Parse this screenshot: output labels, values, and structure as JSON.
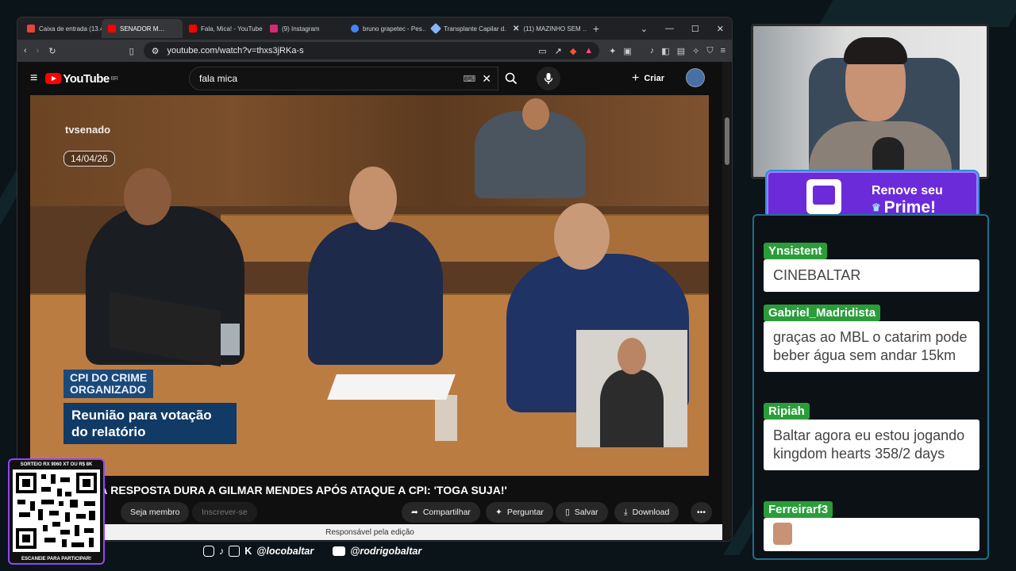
{
  "browser": {
    "tabs": [
      {
        "label": "Caixa de entrada (13.4…",
        "icon": "gmail-icon",
        "color": "#ea4335"
      },
      {
        "label": "SENADOR M…",
        "icon": "youtube-icon",
        "color": "#ff0000",
        "active": true
      },
      {
        "label": "Fala, Mica! - YouTube",
        "icon": "youtube-icon",
        "color": "#ff0000"
      },
      {
        "label": "(9) Instagram",
        "icon": "instagram-icon",
        "color": "#d62976"
      },
      {
        "label": "bruno grapetec - Pes…",
        "icon": "google-icon",
        "color": "#4285f4"
      },
      {
        "label": "Transplante Capilar d…",
        "icon": "gemini-icon",
        "color": "#8ab4f8"
      },
      {
        "label": "(11) MAZINHO SEM …",
        "icon": "x-icon",
        "color": "#ffffff"
      }
    ],
    "url": "youtube.com/watch?v=thxs3jRKa-s"
  },
  "youtube": {
    "logo": "YouTube",
    "region": "BR",
    "search_value": "fala mica",
    "create_label": "Criar",
    "video": {
      "channel_logo": "tvsenado",
      "date": "14/04/26",
      "lower_third_top": "CPI DO CRIME\nORGANIZADO",
      "lower_third_bottom": "Reunião para votação do relatório"
    },
    "title": "NO MALTA DÁ RESPOSTA DURA A GILMAR MENDES APÓS ATAQUE A CPI: 'TOGA SUJA!'",
    "actions": {
      "member": "Seja membro",
      "subscribe": "Inscrever-se",
      "share": "Compartilhar",
      "ask": "Perguntar",
      "save": "Salvar",
      "download": "Download"
    },
    "status_text": "Responsável pela edição"
  },
  "overlay": {
    "socials": {
      "primary": "@locobaltar",
      "youtube": "@rodrigobaltar"
    },
    "qr_top": "SORTEIO RX 9060 XT OU R$ 8K",
    "qr_bottom": "ESCANEIE PARA PARTICIPAR!",
    "prime": {
      "line1": "Renove seu",
      "line2": "Prime!"
    },
    "chat": [
      {
        "user": "Ynsistent",
        "text": "CINEBALTAR"
      },
      {
        "user": "Gabriel_Madridista",
        "text": "graças ao MBL o catarim pode beber água sem andar 15km"
      },
      {
        "user": "Ripiah",
        "text": "Baltar agora eu estou jogando kingdom hearts 358/2 days"
      },
      {
        "user": "Ferreirarf3",
        "text": ""
      }
    ]
  }
}
